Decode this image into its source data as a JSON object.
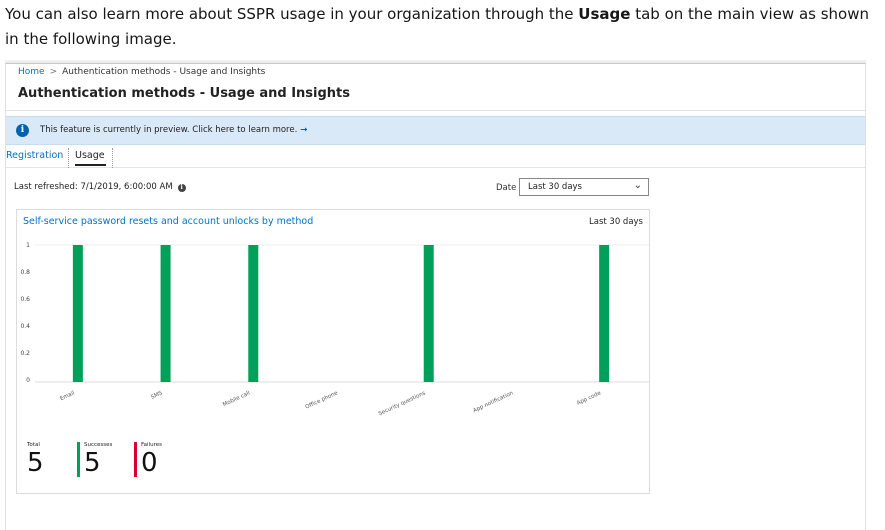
{
  "intro": {
    "before": "You can also learn more about SSPR usage in your organization through the ",
    "bold": "Usage",
    "after": " tab on the main view as shown in the following image."
  },
  "breadcrumb": {
    "home": "Home",
    "separator": ">",
    "current": "Authentication methods - Usage and Insights"
  },
  "page_title": "Authentication methods - Usage and Insights",
  "banner": {
    "icon": "info-icon",
    "text": "This feature is currently in preview. Click here to learn more.",
    "arrow": "→"
  },
  "tabs": [
    {
      "label": "Registration",
      "selected": false
    },
    {
      "label": "Usage",
      "selected": true
    }
  ],
  "last_refreshed": "Last refreshed: 7/1/2019, 6:00:00 AM",
  "date_filter": {
    "label": "Date",
    "selected": "Last 30 days"
  },
  "chart_card": {
    "title": "Self-service password resets and account unlocks by method",
    "range": "Last 30 days"
  },
  "chart_data": {
    "type": "bar",
    "title": "Self-service password resets and account unlocks by method",
    "categories": [
      "Email",
      "SMS",
      "Mobile call",
      "Office phone",
      "Security questions",
      "App notification",
      "App code"
    ],
    "values": [
      1,
      1,
      1,
      0,
      1,
      0,
      1
    ],
    "yticks": [
      "0",
      "0.2",
      "0.4",
      "0.6",
      "0.8",
      "1"
    ],
    "ylim": [
      0,
      1
    ],
    "bar_color": "#00a05a",
    "grid": true
  },
  "stats": {
    "total": {
      "label": "Total",
      "value": "5"
    },
    "successes": {
      "label": "Successes",
      "value": "5",
      "color": "#00a05a"
    },
    "failures": {
      "label": "Failures",
      "value": "0",
      "color": "#d9002c"
    }
  }
}
